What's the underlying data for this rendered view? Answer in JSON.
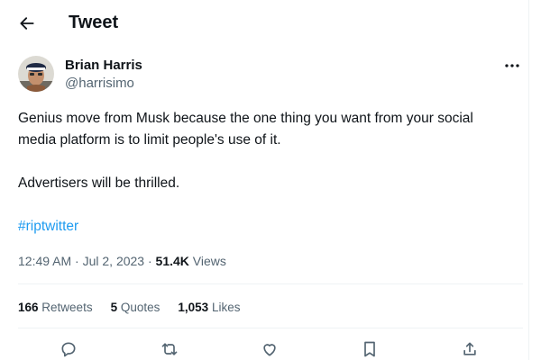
{
  "header": {
    "title": "Tweet"
  },
  "tweet": {
    "author": {
      "name": "Brian Harris",
      "handle": "@harrisimo"
    },
    "paragraph1": "Genius move from Musk because the one thing you want from your social media platform is to limit people's use of it.",
    "paragraph2": "Advertisers will be thrilled.",
    "hashtag": "#riptwitter",
    "timestamp": "12:49 AM · Jul 2, 2023 · ",
    "views_count": "51.4K",
    "views_label": "Views",
    "retweets_count": "166",
    "retweets_label": "Retweets",
    "quotes_count": "5",
    "quotes_label": "Quotes",
    "likes_count": "1,053",
    "likes_label": "Likes"
  },
  "icons": [
    "back-arrow-icon",
    "more-icon",
    "reply-icon",
    "retweet-icon",
    "like-icon",
    "bookmark-icon",
    "share-icon"
  ],
  "colors": {
    "link": "#1d9bf0",
    "secondary": "#536471",
    "text": "#0f1419",
    "divider": "#eff3f4"
  }
}
